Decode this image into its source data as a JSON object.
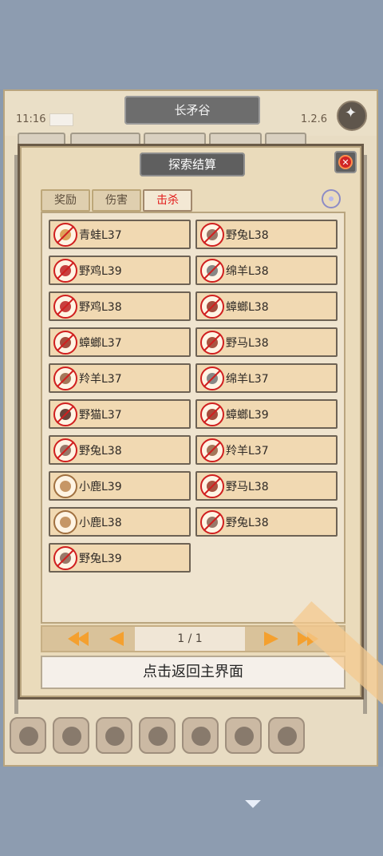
{
  "status_bar": {
    "time": "11:16",
    "version": "1.2.6"
  },
  "location": {
    "title": "长矛谷"
  },
  "dialog": {
    "title": "探索结算",
    "tabs": [
      {
        "label": "奖励",
        "active": false
      },
      {
        "label": "伤害",
        "active": false
      },
      {
        "label": "击杀",
        "active": true
      }
    ],
    "entries": [
      {
        "name": "青蛙L37",
        "icon": "frog-icon",
        "color": "#d99a4a"
      },
      {
        "name": "野兔L38",
        "icon": "rabbit-icon",
        "color": "#8d6a5b"
      },
      {
        "name": "野鸡L39",
        "icon": "pheasant-icon",
        "color": "#c12b2b"
      },
      {
        "name": "绵羊L38",
        "icon": "sheep-icon",
        "color": "#7b7b7b"
      },
      {
        "name": "野鸡L38",
        "icon": "pheasant-icon",
        "color": "#c12b2b"
      },
      {
        "name": "蟑螂L38",
        "icon": "cockroach-icon",
        "color": "#9b3a2a"
      },
      {
        "name": "蟑螂L37",
        "icon": "cockroach-icon",
        "color": "#9b3a2a"
      },
      {
        "name": "野马L38",
        "icon": "horse-icon",
        "color": "#a0432f"
      },
      {
        "name": "羚羊L37",
        "icon": "antelope-icon",
        "color": "#9a6a4a"
      },
      {
        "name": "绵羊L37",
        "icon": "sheep-icon",
        "color": "#7b7b7b"
      },
      {
        "name": "野猫L37",
        "icon": "wildcat-icon",
        "color": "#5b3127"
      },
      {
        "name": "蟑螂L39",
        "icon": "cockroach-icon",
        "color": "#9b3a2a"
      },
      {
        "name": "野兔L38",
        "icon": "rabbit-icon",
        "color": "#8d6a5b"
      },
      {
        "name": "羚羊L37",
        "icon": "antelope-icon",
        "color": "#9a6a4a"
      },
      {
        "name": "小鹿L39",
        "icon": "fawn-icon",
        "color": "#c08c58",
        "strike": false
      },
      {
        "name": "野马L38",
        "icon": "horse-icon",
        "color": "#a0432f"
      },
      {
        "name": "小鹿L38",
        "icon": "fawn-icon",
        "color": "#c08c58",
        "strike": false
      },
      {
        "name": "野兔L38",
        "icon": "rabbit-icon",
        "color": "#8d6a5b"
      },
      {
        "name": "野兔L39",
        "icon": "rabbit-icon",
        "color": "#8d6a5b"
      }
    ],
    "pagination": {
      "page_text": "1 / 1"
    },
    "return_button": "点击返回主界面"
  }
}
